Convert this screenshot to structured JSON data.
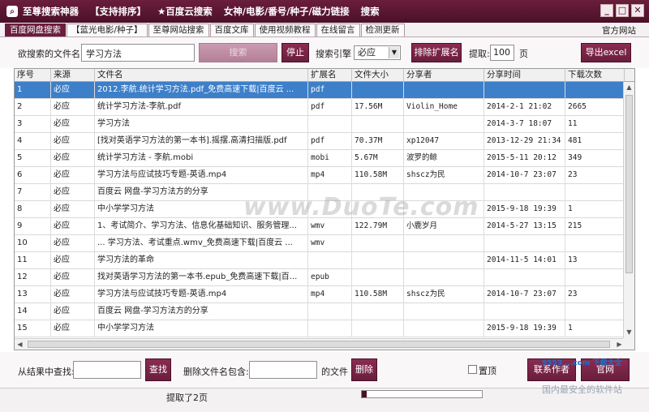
{
  "titlebar": {
    "app_name": "至尊搜索神器",
    "menu": [
      "【支持排序】",
      "★百度云搜索",
      "女神/电影/番号/种子/磁力链接",
      "搜索"
    ],
    "window_buttons": [
      "_",
      "□",
      "✕"
    ]
  },
  "tabs": [
    {
      "label": "百度网盘搜索",
      "active": true
    },
    {
      "label": "【蓝光电影/种子】",
      "active": false
    },
    {
      "label": "至尊网站搜索",
      "active": false
    },
    {
      "label": "百度文库",
      "active": false
    },
    {
      "label": "使用视频教程",
      "active": false
    },
    {
      "label": "在线留言",
      "active": false
    },
    {
      "label": "检测更新",
      "active": false
    }
  ],
  "official_link": "官方网站",
  "search": {
    "filename_label": "欲搜索的文件名:",
    "filename_value": "学习方法",
    "search_button": "搜索",
    "stop_button": "停止",
    "engine_label": "搜索引擎",
    "engine_value": "必应",
    "exclude_button": "排除扩展名",
    "extract_label": "提取:",
    "extract_value": "100",
    "page_unit": "页",
    "export_button": "导出excel"
  },
  "grid": {
    "columns": [
      "序号",
      "来源",
      "文件名",
      "扩展名",
      "文件大小",
      "分享者",
      "分享时间",
      "下载次数"
    ],
    "rows": [
      [
        "1",
        "必应",
        "2012.李航.统计学习方法.pdf_免费高速下载|百度云 ...",
        "pdf",
        "",
        "",
        "",
        ""
      ],
      [
        "2",
        "必应",
        "统计学习方法-李航.pdf",
        "pdf",
        "17.56M",
        "Violin_Home",
        "2014-2-1 21:02",
        "2665"
      ],
      [
        "3",
        "必应",
        "学习方法",
        "",
        "",
        "",
        "2014-3-7 18:07",
        "11"
      ],
      [
        "4",
        "必应",
        "[找对英语学习方法的第一本书].摇摆.高清扫描版.pdf",
        "pdf",
        "70.37M",
        "xp12047",
        "2013-12-29 21:34",
        "481"
      ],
      [
        "5",
        "必应",
        "统计学习方法 - 李航.mobi",
        "mobi",
        "5.67M",
        "波罗的鲸",
        "2015-5-11 20:12",
        "349"
      ],
      [
        "6",
        "必应",
        "学习方法与应试技巧专题-英语.mp4",
        "mp4",
        "110.58M",
        "shscz为民",
        "2014-10-7 23:07",
        "23"
      ],
      [
        "7",
        "必应",
        "百度云 网盘-学习方法方的分享",
        "",
        "",
        "",
        "",
        ""
      ],
      [
        "8",
        "必应",
        "中小学学习方法",
        "",
        "",
        "",
        "2015-9-18 19:39",
        "1"
      ],
      [
        "9",
        "必应",
        "1、考试简介、学习方法、信息化基础知识、服务管理...",
        "wmv",
        "122.79M",
        "小鹿岁月",
        "2014-5-27 13:15",
        "215"
      ],
      [
        "10",
        "必应",
        "... 学习方法、考试重点.wmv_免费高速下载|百度云 ...",
        "wmv",
        "",
        "",
        "",
        ""
      ],
      [
        "11",
        "必应",
        "学习方法的革命",
        "",
        "",
        "",
        "2014-11-5 14:01",
        "13"
      ],
      [
        "12",
        "必应",
        "找对英语学习方法的第一本书.epub_免费高速下载|百...",
        "epub",
        "",
        "",
        "",
        ""
      ],
      [
        "13",
        "必应",
        "学习方法与应试技巧专题-英语.mp4",
        "mp4",
        "110.58M",
        "shscz为民",
        "2014-10-7 23:07",
        "23"
      ],
      [
        "14",
        "必应",
        "百度云 网盘-学习方法方的分享",
        "",
        "",
        "",
        "",
        ""
      ],
      [
        "15",
        "必应",
        "中小学学习方法",
        "",
        "",
        "",
        "2015-9-18 19:39",
        "1"
      ]
    ],
    "selected_row": 0
  },
  "watermark": "www.DuoTe.com",
  "bottom": {
    "filter_label": "从结果中查找:",
    "filter_button": "查找",
    "delete_label": "删除文件名包含:",
    "delete_suffix": "的文件",
    "delete_button": "删除",
    "pin_label": "置顶",
    "contact_button": "联系作者",
    "website_button": "官网"
  },
  "status": {
    "text": "提取了2页",
    "progress": 0.04
  },
  "logo_watermark": {
    "line1": "9553 ...com 下载大全",
    "line2": "国内最安全的软件站"
  },
  "colors": {
    "accent": "#6a1e3c",
    "selected_row": "#3d7fc9"
  }
}
